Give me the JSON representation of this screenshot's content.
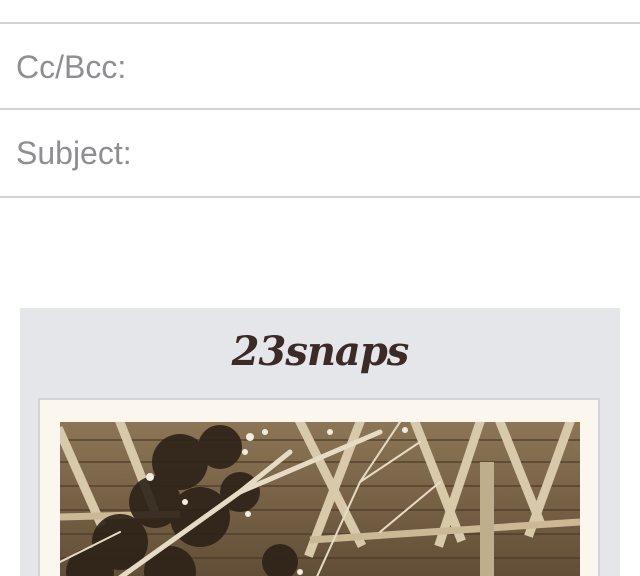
{
  "compose": {
    "cc_bcc_label": "Cc/Bcc:",
    "subject_label": "Subject:"
  },
  "card": {
    "logo_text": "23snaps",
    "logo_color": "#3b2a25",
    "background": "#e5e6ea"
  },
  "photo": {
    "tone": "sepia",
    "subject": "tree branches in front of a wooden fence"
  }
}
